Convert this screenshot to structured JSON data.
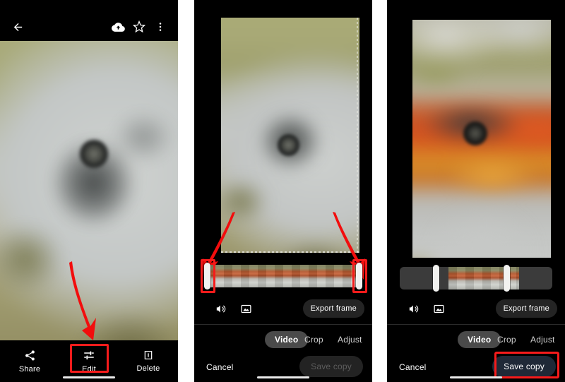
{
  "screenshot": {
    "description": "Google Photos video trim tutorial, three phone screenshots side by side",
    "panel_count": 3,
    "accent_highlight_color": "#f61b1b",
    "save_enabled_color": "#1f2937",
    "background_color": "#000000"
  },
  "panel1": {
    "name": "photo-viewer",
    "topbar": {
      "back_icon": "back-arrow-icon",
      "cloud_icon": "cloud-upload-icon",
      "star_icon": "star-outline-icon",
      "more_icon": "more-vertical-icon"
    },
    "bottombar": {
      "items": [
        {
          "label": "Share",
          "icon": "share-icon",
          "highlighted": false
        },
        {
          "label": "Edit",
          "icon": "tune-sliders-icon",
          "highlighted": true
        },
        {
          "label": "Delete",
          "icon": "trash-icon",
          "highlighted": false
        }
      ]
    },
    "annotation": {
      "arrow": "red-arrow-pointing-down-to-edit"
    }
  },
  "panel2": {
    "name": "video-editor-untrimmed",
    "timeline": {
      "trim_start_percent": 0,
      "trim_end_percent": 100,
      "left_handle_highlighted": true,
      "right_handle_highlighted": true
    },
    "tools": {
      "volume_icon": "volume-speaker-icon",
      "stabilize_icon": "stabilize-frame-icon",
      "export_frame_label": "Export frame"
    },
    "tabs": [
      {
        "label": "Video",
        "selected": true
      },
      {
        "label": "Crop",
        "selected": false
      },
      {
        "label": "Adjust",
        "selected": false
      }
    ],
    "actions": {
      "cancel_label": "Cancel",
      "save_label": "Save copy",
      "save_enabled": false,
      "save_highlighted": false
    },
    "annotation": {
      "arrows": "two-red-arrows-pointing-to-trim-handles"
    }
  },
  "panel3": {
    "name": "video-editor-trimmed",
    "timeline": {
      "trim_start_percent": 32,
      "trim_end_percent": 78,
      "left_handle_highlighted": false,
      "right_handle_highlighted": false
    },
    "tools": {
      "volume_icon": "volume-speaker-icon",
      "stabilize_icon": "stabilize-frame-icon",
      "export_frame_label": "Export frame"
    },
    "tabs": [
      {
        "label": "Video",
        "selected": true
      },
      {
        "label": "Crop",
        "selected": false
      },
      {
        "label": "Adjust",
        "selected": false
      }
    ],
    "actions": {
      "cancel_label": "Cancel",
      "save_label": "Save copy",
      "save_enabled": true,
      "save_highlighted": true
    }
  }
}
